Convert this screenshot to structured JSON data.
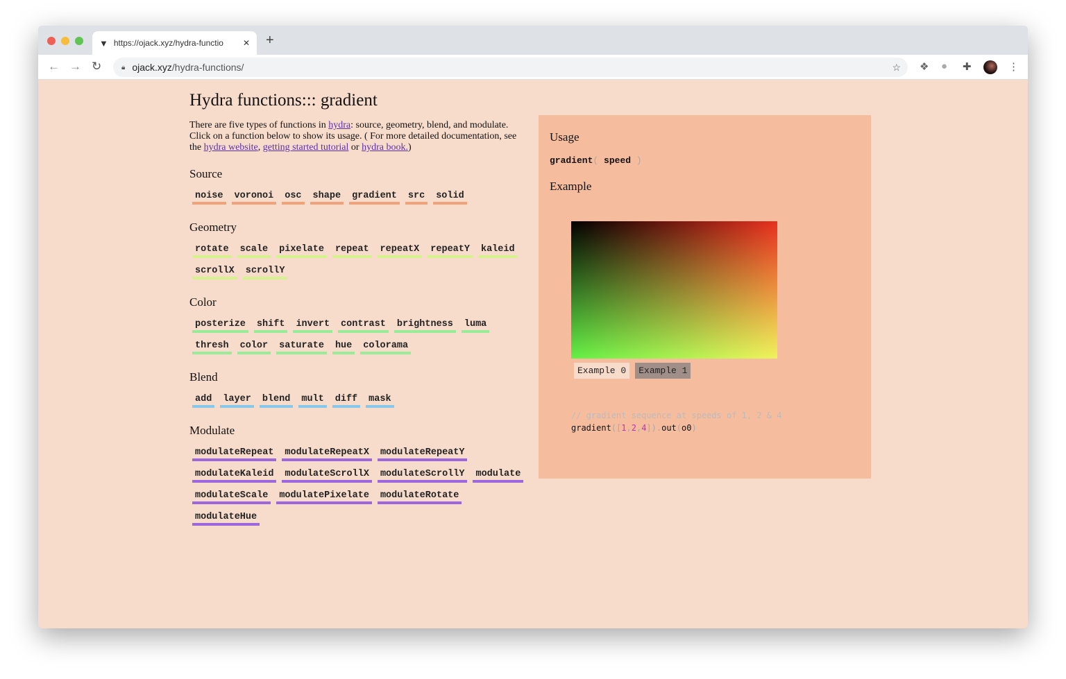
{
  "browser": {
    "tab_title": "https://ojack.xyz/hydra-functio",
    "url_host": "ojack.xyz",
    "url_path": "/hydra-functions/"
  },
  "page": {
    "title": "Hydra functions::: gradient",
    "intro": {
      "t1": "There are five types of functions in ",
      "l1": "hydra",
      "t2": ": source, geometry, blend, and modulate. Click on a function below to show its usage. ( For more detailed documentation, see the ",
      "l2": "hydra website",
      "t3": ", ",
      "l3": "getting started tutorial",
      "t4": " or ",
      "l4": "hydra book.",
      "t5": ")"
    },
    "sections": [
      {
        "title": "Source",
        "items": [
          "noise",
          "voronoi",
          "osc",
          "shape",
          "gradient",
          "src",
          "solid"
        ]
      },
      {
        "title": "Geometry",
        "items": [
          "rotate",
          "scale",
          "pixelate",
          "repeat",
          "repeatX",
          "repeatY",
          "kaleid",
          "scrollX",
          "scrollY"
        ]
      },
      {
        "title": "Color",
        "items": [
          "posterize",
          "shift",
          "invert",
          "contrast",
          "brightness",
          "luma",
          "thresh",
          "color",
          "saturate",
          "hue",
          "colorama"
        ]
      },
      {
        "title": "Blend",
        "items": [
          "add",
          "layer",
          "blend",
          "mult",
          "diff",
          "mask"
        ]
      },
      {
        "title": "Modulate",
        "items": [
          "modulateRepeat",
          "modulateRepeatX",
          "modulateRepeatY",
          "modulateKaleid",
          "modulateScrollX",
          "modulateScrollY",
          "modulate",
          "modulateScale",
          "modulatePixelate",
          "modulateRotate",
          "modulateHue"
        ]
      }
    ]
  },
  "panel": {
    "usage_title": "Usage",
    "fn": "gradient",
    "open": "(",
    "arg": "speed",
    "close": ")",
    "example_title": "Example",
    "examples": [
      "Example 0",
      "Example 1"
    ],
    "active_example": 1,
    "code": {
      "comment": "// gradient sequence at speeds of 1, 2 & 4",
      "c1": "gradient",
      "c2": "([",
      "n1": "1",
      "s1": ",",
      "n2": "2",
      "s2": ",",
      "n3": "4",
      "c3": "]).",
      "c4": "out",
      "c5": "(",
      "c6": "o0",
      "c7": ")"
    }
  }
}
